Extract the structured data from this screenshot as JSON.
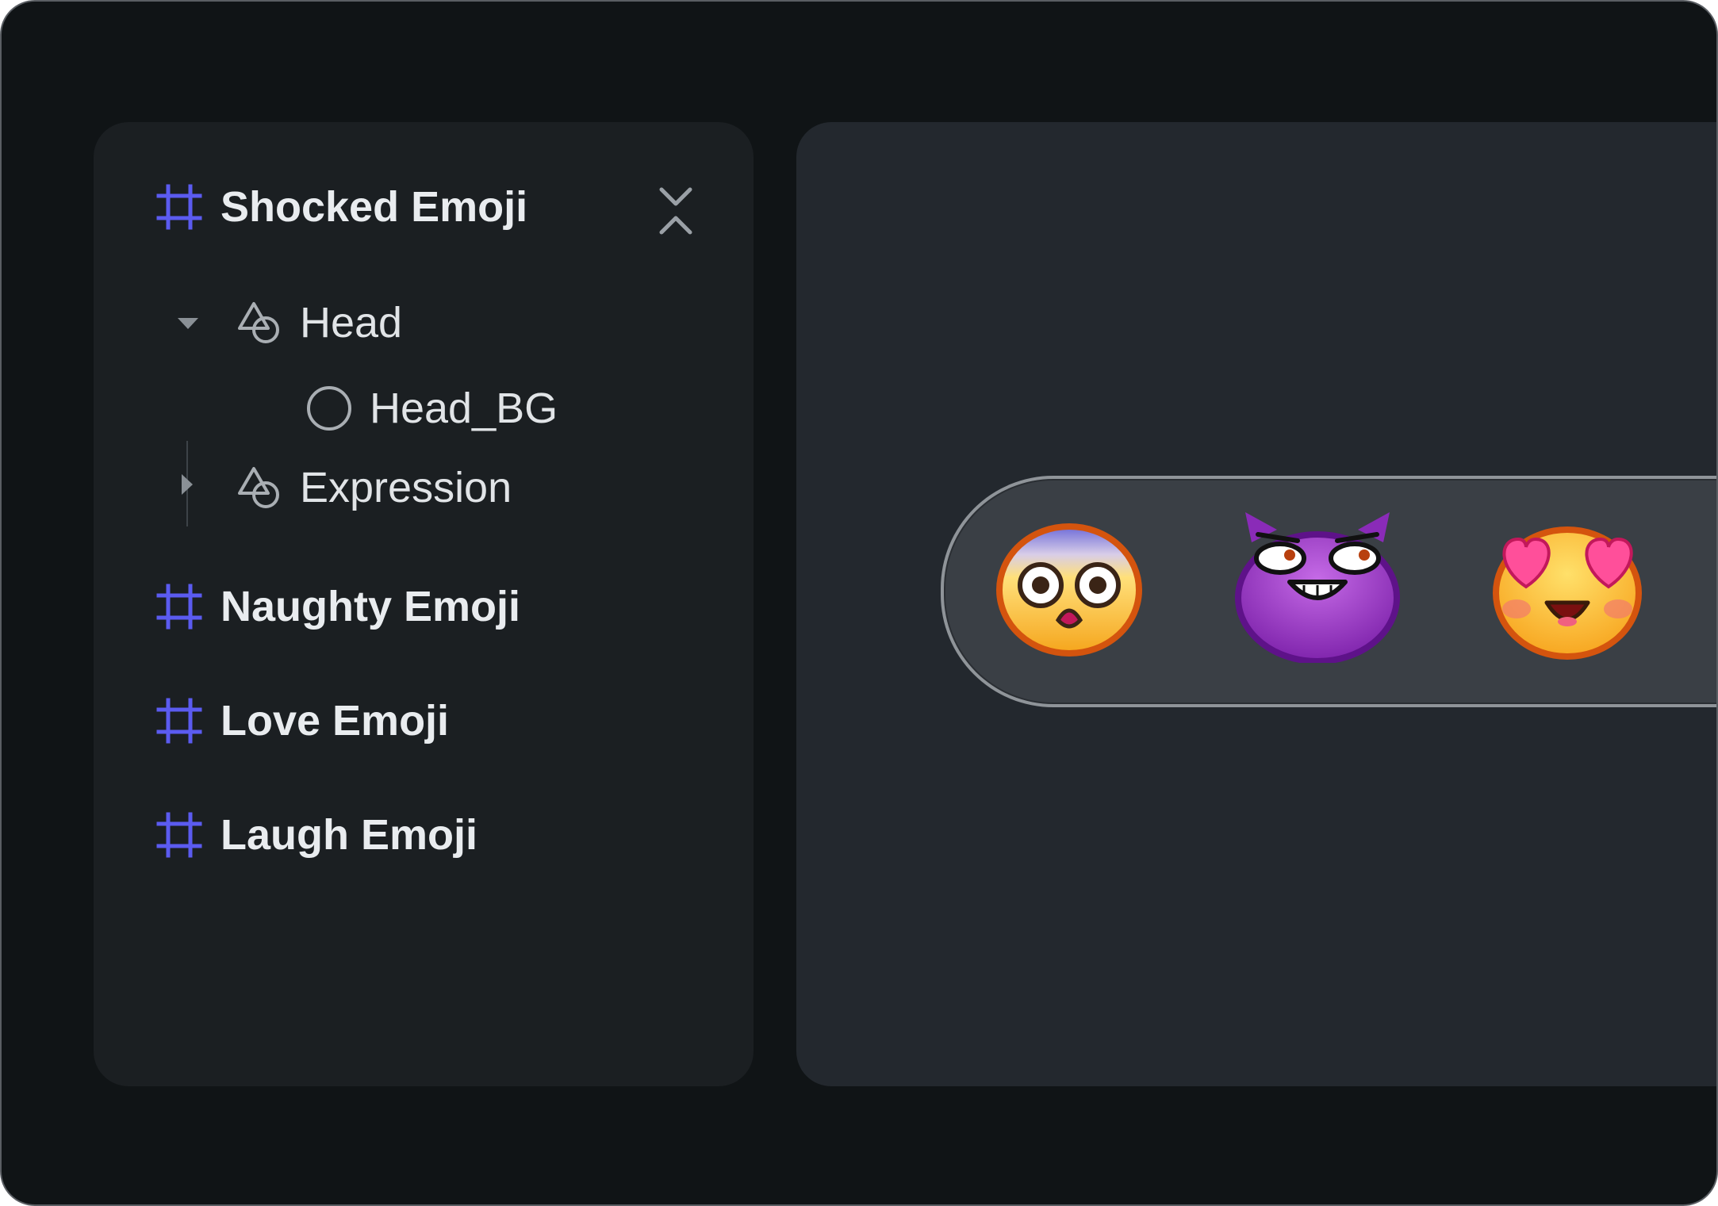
{
  "layers": {
    "frames": [
      {
        "id": "shocked",
        "label": "Shocked Emoji",
        "expanded": true
      },
      {
        "id": "naughty",
        "label": "Naughty Emoji",
        "expanded": false
      },
      {
        "id": "love",
        "label": "Love Emoji",
        "expanded": false
      },
      {
        "id": "laugh",
        "label": "Laugh Emoji",
        "expanded": false
      }
    ],
    "children": {
      "head": {
        "label": "Head",
        "icon": "shapes-icon",
        "expanded": true
      },
      "head_bg": {
        "label": "Head_BG",
        "icon": "ellipse-icon"
      },
      "expression": {
        "label": "Expression",
        "icon": "shapes-icon",
        "expanded": false
      }
    },
    "collapse_icon": "collapse-all-icon"
  },
  "canvas": {
    "emojis": [
      {
        "name": "shocked-emoji",
        "icon": "shocked-face"
      },
      {
        "name": "naughty-emoji",
        "icon": "smirking-devil-face"
      },
      {
        "name": "love-emoji",
        "icon": "heart-eyes-face"
      }
    ]
  },
  "colors": {
    "frame_icon": "#5b5bf0",
    "window_bg": "#101416",
    "panel_bg": "#1b1f22",
    "canvas_bg": "#23282e",
    "pill_bg": "#3a3f45"
  }
}
